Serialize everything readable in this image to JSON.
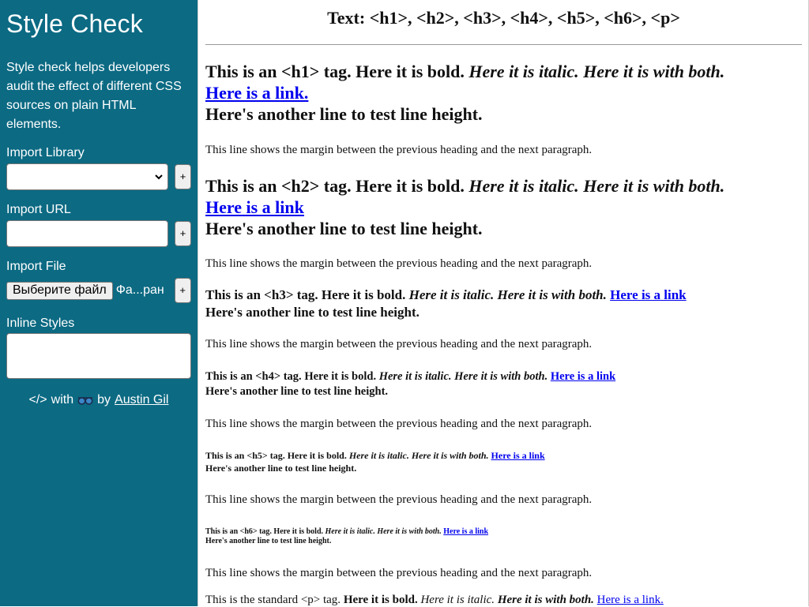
{
  "sidebar": {
    "title": "Style Check",
    "description": "Style check helps developers audit the effect of different CSS sources on plain HTML elements.",
    "import_library_label": "Import Library",
    "import_library_value": "",
    "import_url_label": "Import URL",
    "import_url_value": "",
    "import_file_label": "Import File",
    "file_button_label": "Выберите файл",
    "file_name": "Фа...ран",
    "inline_styles_label": "Inline Styles",
    "inline_styles_value": "",
    "plus_label": "+",
    "footer": {
      "code_glyph": "</>",
      "with": "with",
      "by": "by",
      "author": "Austin Gil",
      "icon": "glasses-icon"
    }
  },
  "main": {
    "title": "Text: <h1>, <h2>, <h3>, <h4>, <h5>, <h6>, <p>",
    "headings": [
      {
        "prefix": "This is an <h1> tag. ",
        "bold": "Here it is bold.",
        "italic": "Here it is italic.",
        "both": "Here it is with both.",
        "link": "Here is a link.",
        "line2": "Here's another line to test line height."
      },
      {
        "prefix": "This is an <h2> tag. ",
        "bold": "Here it is bold.",
        "italic": "Here it is italic.",
        "both": "Here it is with both.",
        "link": "Here is a link",
        "line2": "Here's another line to test line height."
      },
      {
        "prefix": "This is an <h3> tag. ",
        "bold": "Here it is bold.",
        "italic": "Here it is italic.",
        "both": "Here it is with both.",
        "link": "Here is a link",
        "line2": "Here's another line to test line height."
      },
      {
        "prefix": "This is an <h4> tag. ",
        "bold": "Here it is bold.",
        "italic": "Here it is italic.",
        "both": "Here it is with both.",
        "link": "Here is a link",
        "line2": "Here's another line to test line height."
      },
      {
        "prefix": "This is an <h5> tag. ",
        "bold": "Here it is bold.",
        "italic": "Here it is italic.",
        "both": "Here it is with both.",
        "link": "Here is a link",
        "line2": "Here's another line to test line height."
      },
      {
        "prefix": "This is an <h6> tag. ",
        "bold": "Here it is bold.",
        "italic": "Here it is italic.",
        "both": "Here it is with both.",
        "link": "Here is a link",
        "line2": "Here's another line to test line height."
      }
    ],
    "margin_paragraph": "This line shows the margin between the previous heading and the next paragraph.",
    "standard_p": {
      "prefix": "This is the standard <p> tag. ",
      "bold": "Here it is bold.",
      "italic": "Here it is italic.",
      "both": "Here it is with both.",
      "link": "Here is a link."
    }
  },
  "colors": {
    "sidebar_bg": "#0c6a83",
    "link": "#0000ee"
  }
}
